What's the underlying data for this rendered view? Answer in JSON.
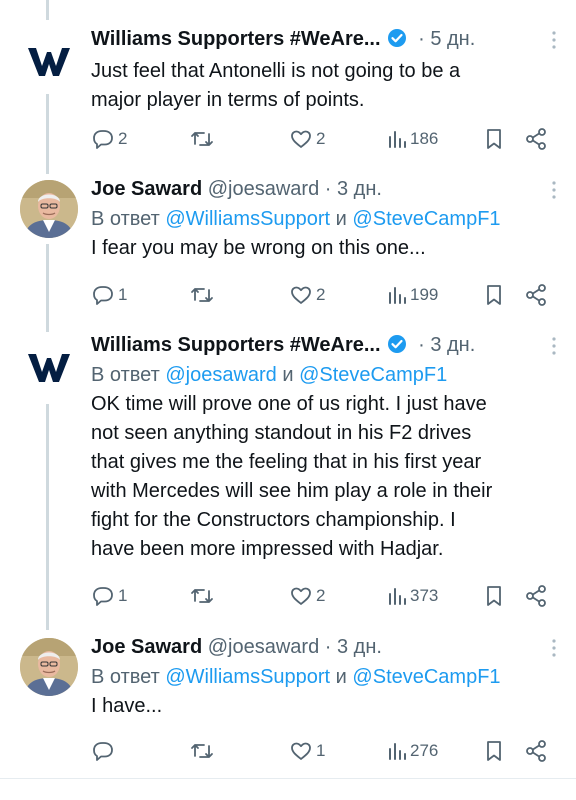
{
  "tweets": [
    {
      "name": "Williams Supporters #WeAre...",
      "verified": true,
      "handle": "",
      "dot": "·",
      "time": "5 дн.",
      "reply_prefix": "",
      "reply_a": "",
      "reply_sep": "",
      "reply_b": "",
      "lines": [
        "Just feel that Antonelli is not going to be a",
        "major player in terms of points."
      ],
      "replies": "2",
      "retweets": "",
      "likes": "2",
      "views": "186"
    },
    {
      "name": "Joe Saward",
      "verified": false,
      "handle": "@joesaward",
      "dot": "·",
      "time": "3 дн.",
      "reply_prefix": "В ответ ",
      "reply_a": "@WilliamsSupport",
      "reply_sep": " и ",
      "reply_b": "@SteveCampF1",
      "lines": [
        "I fear you may be wrong on this one..."
      ],
      "replies": "1",
      "retweets": "",
      "likes": "2",
      "views": "199"
    },
    {
      "name": "Williams Supporters #WeAre...",
      "verified": true,
      "handle": "",
      "dot": "·",
      "time": "3 дн.",
      "reply_prefix": "В ответ ",
      "reply_a": "@joesaward",
      "reply_sep": " и ",
      "reply_b": "@SteveCampF1",
      "lines": [
        "OK time will prove one of us right. I just have",
        "not seen anything standout in his F2 drives",
        "that gives me the feeling that in his first year",
        "with Mercedes will see him play a role in their",
        "fight for the Constructors championship. I",
        "have been more impressed with Hadjar."
      ],
      "replies": "1",
      "retweets": "",
      "likes": "2",
      "views": "373"
    },
    {
      "name": "Joe Saward",
      "verified": false,
      "handle": "@joesaward",
      "dot": "·",
      "time": "3 дн.",
      "reply_prefix": "В ответ ",
      "reply_a": "@WilliamsSupport",
      "reply_sep": " и ",
      "reply_b": "@SteveCampF1",
      "lines": [
        "I have..."
      ],
      "replies": "",
      "retweets": "",
      "likes": "1",
      "views": "276"
    }
  ],
  "colors": {
    "accent": "#1d9bf0",
    "muted": "#536471",
    "text": "#0f1419",
    "williams_blue": "#041e42"
  },
  "icons": {
    "reply": "comment-icon",
    "retweet": "retweet-icon",
    "like": "heart-icon",
    "views": "views-icon",
    "bookmark": "bookmark-icon",
    "share": "share-icon",
    "more": "more-icon",
    "verified": "verified-badge-icon"
  }
}
